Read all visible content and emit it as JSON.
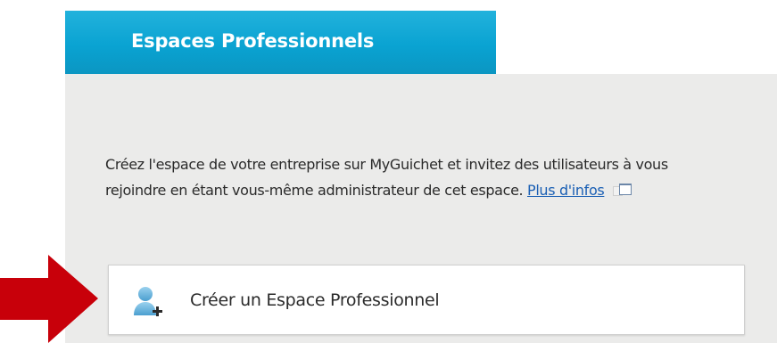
{
  "tab": {
    "title": "Espaces Professionnels"
  },
  "description": {
    "text": "Créez l'espace de votre entreprise sur MyGuichet et invitez des utilisateurs à vous rejoindre en étant vous-même administrateur de cet espace.",
    "link_label": "Plus d'infos",
    "link_icon": "external-window-icon"
  },
  "create_button": {
    "label": "Créer un Espace Professionnel",
    "icon": "add-user-icon"
  },
  "annotation": {
    "icon": "red-arrow-pointer-icon",
    "color": "#c8000a"
  },
  "colors": {
    "tab_background": "#0aa3d2",
    "panel_background": "#ebebea",
    "link": "#1a5fb4"
  }
}
